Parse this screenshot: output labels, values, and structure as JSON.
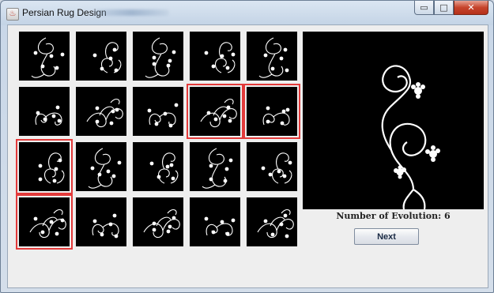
{
  "window": {
    "title": "Persian Rug Design",
    "minimize_glyph": "▭",
    "maximize_glyph": "□",
    "close_glyph": "✕",
    "app_icon": "rug-app-icon"
  },
  "grid": {
    "rows": 4,
    "columns": 5,
    "selected": [
      {
        "row": 2,
        "col": 4
      },
      {
        "row": 2,
        "col": 5
      },
      {
        "row": 3,
        "col": 1
      },
      {
        "row": 4,
        "col": 1
      }
    ],
    "colors": {
      "background": "#000000",
      "stroke": "#ffffff",
      "selection": "#e33a3a"
    }
  },
  "preview": {
    "evolution_text": "Number of Evolution: 6",
    "next_label": "Next"
  }
}
